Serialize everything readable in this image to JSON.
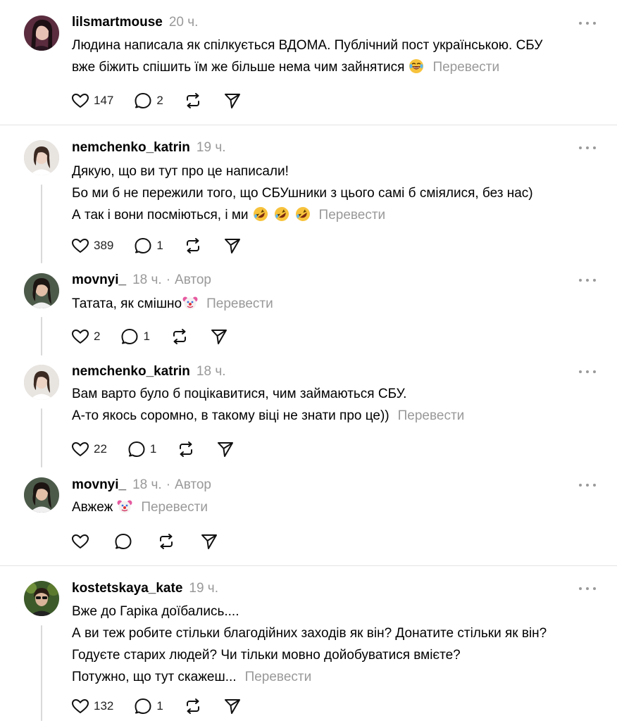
{
  "posts": [
    {
      "username": "lilsmartmouse",
      "time": "20 ч.",
      "author_badge": "",
      "lines": [
        "Людина написала як спілкується ВДОМА. Публічний пост українською. СБУ",
        "вже біжить спішить їм же більше нема чим зайнятися"
      ],
      "emoji": "face-with-tears-of-joy",
      "translate": "Перевести",
      "likes": "147",
      "replies": "2"
    },
    {
      "username": "nemchenko_katrin",
      "time": "19 ч.",
      "author_badge": "",
      "lines": [
        "Дякую, що ви тут про це написали!",
        "Бо ми б не пережили того, що СБУшники з цього самі б сміялися, без нас)",
        "А так і вони посміються, і ми"
      ],
      "emoji": "rolling-on-floor-laughing x3",
      "translate": "Перевести",
      "likes": "389",
      "replies": "1"
    },
    {
      "username": "movnyi_",
      "time": "18 ч.",
      "author_badge": "Автор",
      "lines": [
        "Татата, як смішно"
      ],
      "emoji": "clown-face",
      "translate": "Перевести",
      "likes": "2",
      "replies": "1"
    },
    {
      "username": "nemchenko_katrin",
      "time": "18 ч.",
      "author_badge": "",
      "lines": [
        "Вам варто було б поцікавитися, чим займаються СБУ.",
        "А-то якось соромно, в такому віці не знати про це))"
      ],
      "emoji": "",
      "translate": "Перевести",
      "likes": "22",
      "replies": "1"
    },
    {
      "username": "movnyi_",
      "time": "18 ч.",
      "author_badge": "Автор",
      "lines": [
        "Авжеж"
      ],
      "emoji": "clown-face",
      "translate": "Перевести",
      "likes": "",
      "replies": ""
    },
    {
      "username": "kostetskaya_kate",
      "time": "19 ч.",
      "author_badge": "",
      "lines": [
        "Вже до Гаріка доїбались....",
        "А ви теж робите стільки благодійних заходів як він? Донатите стільки як він?",
        "Годуєте старих людей? Чи тільки мовно дойобуватися вмієте?",
        "Потужно, що тут скажеш..."
      ],
      "emoji": "",
      "translate": "Перевести",
      "likes": "132",
      "replies": "1"
    }
  ],
  "separator": "·",
  "icons": {
    "like": "heart-icon",
    "reply": "comment-bubble-icon",
    "repost": "repost-arrows-icon",
    "share": "send-paper-plane-icon",
    "more": "more-dots-icon"
  },
  "colors": {
    "text": "#000000",
    "muted": "#999999",
    "divider": "#e3e3e3",
    "thread_line": "#d9d9d9"
  }
}
